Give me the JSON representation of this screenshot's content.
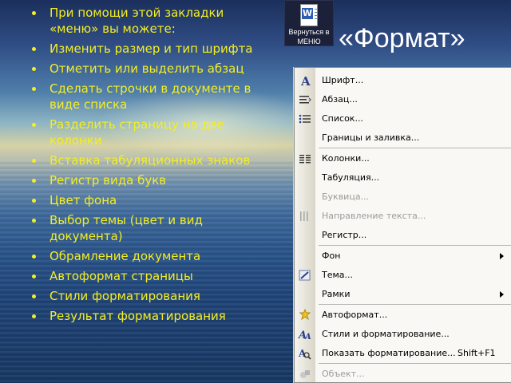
{
  "bullets": [
    "При помощи этой закладки «меню» вы можете:",
    "Изменить размер и тип шрифта",
    "Отметить или выделить абзац",
    "Сделать строчки в документе в виде списка",
    "Разделить страницу на две колонки",
    "Вставка табуляционных знаков",
    "Регистр вида букв",
    "Цвет фона",
    "Выбор темы (цвет и вид документа)",
    "Обрамление документа",
    "Автоформат страницы",
    "Стили форматирования",
    "Результат форматирования"
  ],
  "back_button": {
    "line1": "Вернуться в",
    "line2": "МЕНЮ"
  },
  "title": "«Формат»",
  "menu": {
    "items": [
      {
        "label": "Шрифт...",
        "icon": "font-icon",
        "enabled": true
      },
      {
        "label": "Абзац...",
        "icon": "paragraph-icon",
        "enabled": true
      },
      {
        "label": "Список...",
        "icon": "list-icon",
        "enabled": true
      },
      {
        "label": "Границы и заливка...",
        "icon": "",
        "enabled": true
      },
      {
        "label": "Колонки...",
        "icon": "columns-icon",
        "enabled": true
      },
      {
        "label": "Табуляция...",
        "icon": "",
        "enabled": true
      },
      {
        "label": "Буквица...",
        "icon": "",
        "enabled": false
      },
      {
        "label": "Направление текста...",
        "icon": "text-direction-icon",
        "enabled": false
      },
      {
        "label": "Регистр...",
        "icon": "",
        "enabled": true
      },
      {
        "label": "Фон",
        "icon": "",
        "enabled": true,
        "submenu": true
      },
      {
        "label": "Тема...",
        "icon": "theme-icon",
        "enabled": true
      },
      {
        "label": "Рамки",
        "icon": "",
        "enabled": true,
        "submenu": true
      },
      {
        "label": "Автоформат...",
        "icon": "autoformat-icon",
        "enabled": true
      },
      {
        "label": "Стили и форматирование...",
        "icon": "styles-icon",
        "enabled": true
      },
      {
        "label": "Показать форматирование...",
        "icon": "reveal-formatting-icon",
        "enabled": true,
        "shortcut": "Shift+F1"
      },
      {
        "label": "Объект...",
        "icon": "object-icon",
        "enabled": false
      }
    ]
  },
  "colors": {
    "bullet_text": "#f4ee22",
    "title": "#ffffff",
    "menu_bg": "#f9f8f4",
    "disabled_text": "#9a9a9a"
  }
}
